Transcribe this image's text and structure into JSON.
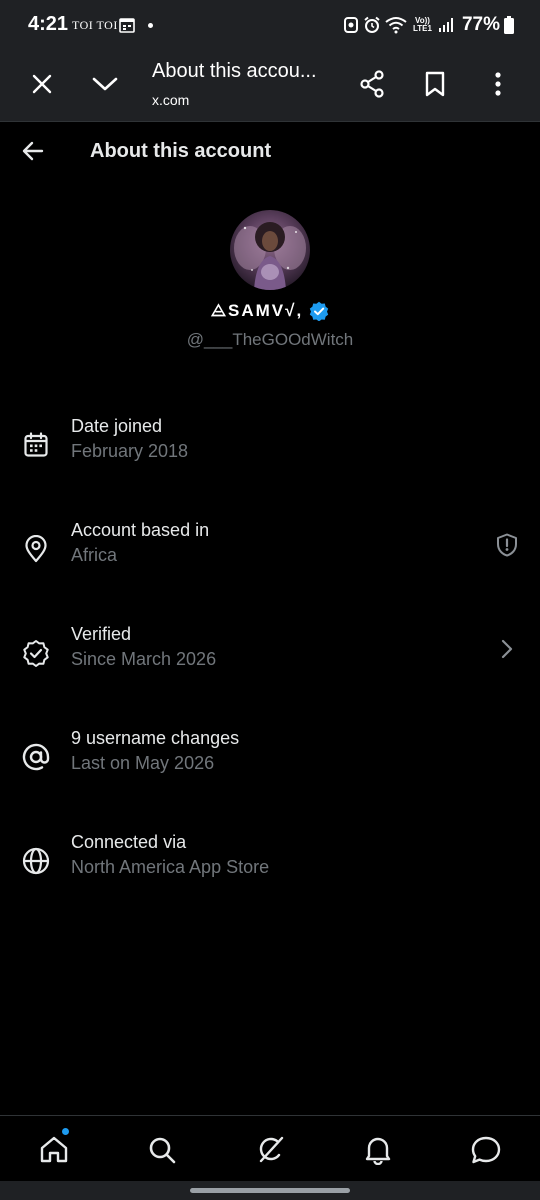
{
  "status_bar": {
    "time": "4:21",
    "carrier": "TOI TOI",
    "volte_top": "Vo))",
    "volte_bottom": "LTE1",
    "battery": "77%"
  },
  "browser": {
    "title": "About this accou...",
    "url": "x.com"
  },
  "page": {
    "title": "About this account"
  },
  "profile": {
    "display_name": "⨺SAMV√,",
    "handle": "@___TheGOOdWitch",
    "verified_color": "#1d9bf0"
  },
  "info": [
    {
      "icon": "calendar-icon",
      "title": "Date joined",
      "subtitle": "February 2018"
    },
    {
      "icon": "location-pin-icon",
      "title": "Account based in",
      "subtitle": "Africa",
      "trailing": "shield-alert-icon"
    },
    {
      "icon": "verified-badge-icon",
      "title": "Verified",
      "subtitle": "Since March 2026",
      "trailing": "chevron-right-icon"
    },
    {
      "icon": "at-sign-icon",
      "title": "9 username changes",
      "subtitle": "Last on May 2026"
    },
    {
      "icon": "globe-icon",
      "title": "Connected via",
      "subtitle": "North America App Store"
    }
  ],
  "bottom_nav": [
    "home-icon",
    "search-icon",
    "grok-icon",
    "notifications-bell-icon",
    "messages-icon"
  ],
  "colors": {
    "background": "#000000",
    "chrome": "#1f2124",
    "text_primary": "#e7e9ea",
    "text_secondary": "#71767b",
    "accent": "#1d9bf0"
  }
}
